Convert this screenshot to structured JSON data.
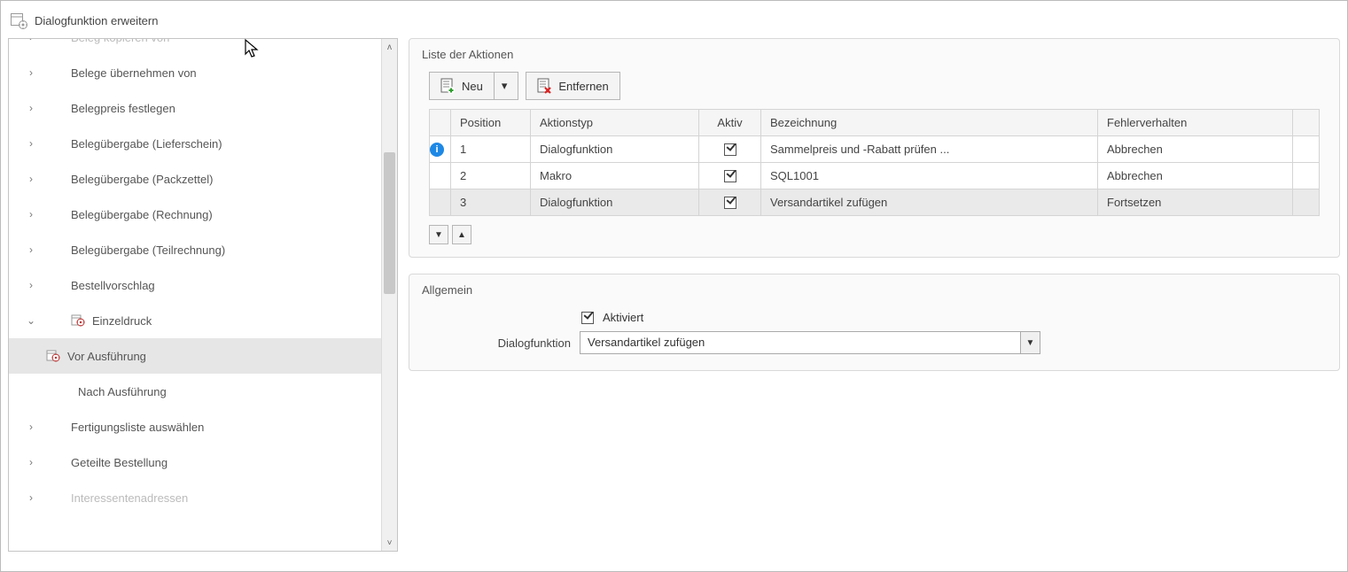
{
  "window": {
    "title": "Dialogfunktion erweitern"
  },
  "tree": {
    "items": [
      {
        "label": "Beleg kopieren von",
        "expander": "›",
        "style": "cut"
      },
      {
        "label": "Belege übernehmen von",
        "expander": "›"
      },
      {
        "label": "Belegpreis festlegen",
        "expander": "›"
      },
      {
        "label": "Belegübergabe (Lieferschein)",
        "expander": "›"
      },
      {
        "label": "Belegübergabe (Packzettel)",
        "expander": "›"
      },
      {
        "label": "Belegübergabe (Rechnung)",
        "expander": "›"
      },
      {
        "label": "Belegübergabe (Teilrechnung)",
        "expander": "›"
      },
      {
        "label": "Bestellvorschlag",
        "expander": "›"
      },
      {
        "label": "Einzeldruck",
        "expander": "v",
        "icon": "gear"
      },
      {
        "label": "Vor Ausführung",
        "level": 2,
        "selected": true,
        "icon": "gear"
      },
      {
        "label": "Nach Ausführung",
        "level": 2,
        "noicon": true
      },
      {
        "label": "Fertigungsliste auswählen",
        "expander": "›"
      },
      {
        "label": "Geteilte Bestellung",
        "expander": "›"
      },
      {
        "label": "Interessentenadressen",
        "expander": "›",
        "style": "fade"
      }
    ]
  },
  "actions": {
    "section_title": "Liste der Aktionen",
    "toolbar": {
      "new": "Neu",
      "remove": "Entfernen"
    },
    "columns": {
      "position": "Position",
      "type": "Aktionstyp",
      "active": "Aktiv",
      "desc": "Bezeichnung",
      "error": "Fehlerverhalten"
    },
    "rows": [
      {
        "position": "1",
        "type": "Dialogfunktion",
        "active": true,
        "desc": "Sammelpreis und -Rabatt prüfen ...",
        "error": "Abbrechen",
        "info": true
      },
      {
        "position": "2",
        "type": "Makro",
        "active": true,
        "desc": "SQL1001",
        "error": "Abbrechen"
      },
      {
        "position": "3",
        "type": "Dialogfunktion",
        "active": true,
        "desc": "Versandartikel zufügen",
        "error": "Fortsetzen",
        "selected": true
      }
    ]
  },
  "general": {
    "section_title": "Allgemein",
    "activated_label": "Aktiviert",
    "activated": true,
    "field_label": "Dialogfunktion",
    "combo_value": "Versandartikel zufügen"
  }
}
